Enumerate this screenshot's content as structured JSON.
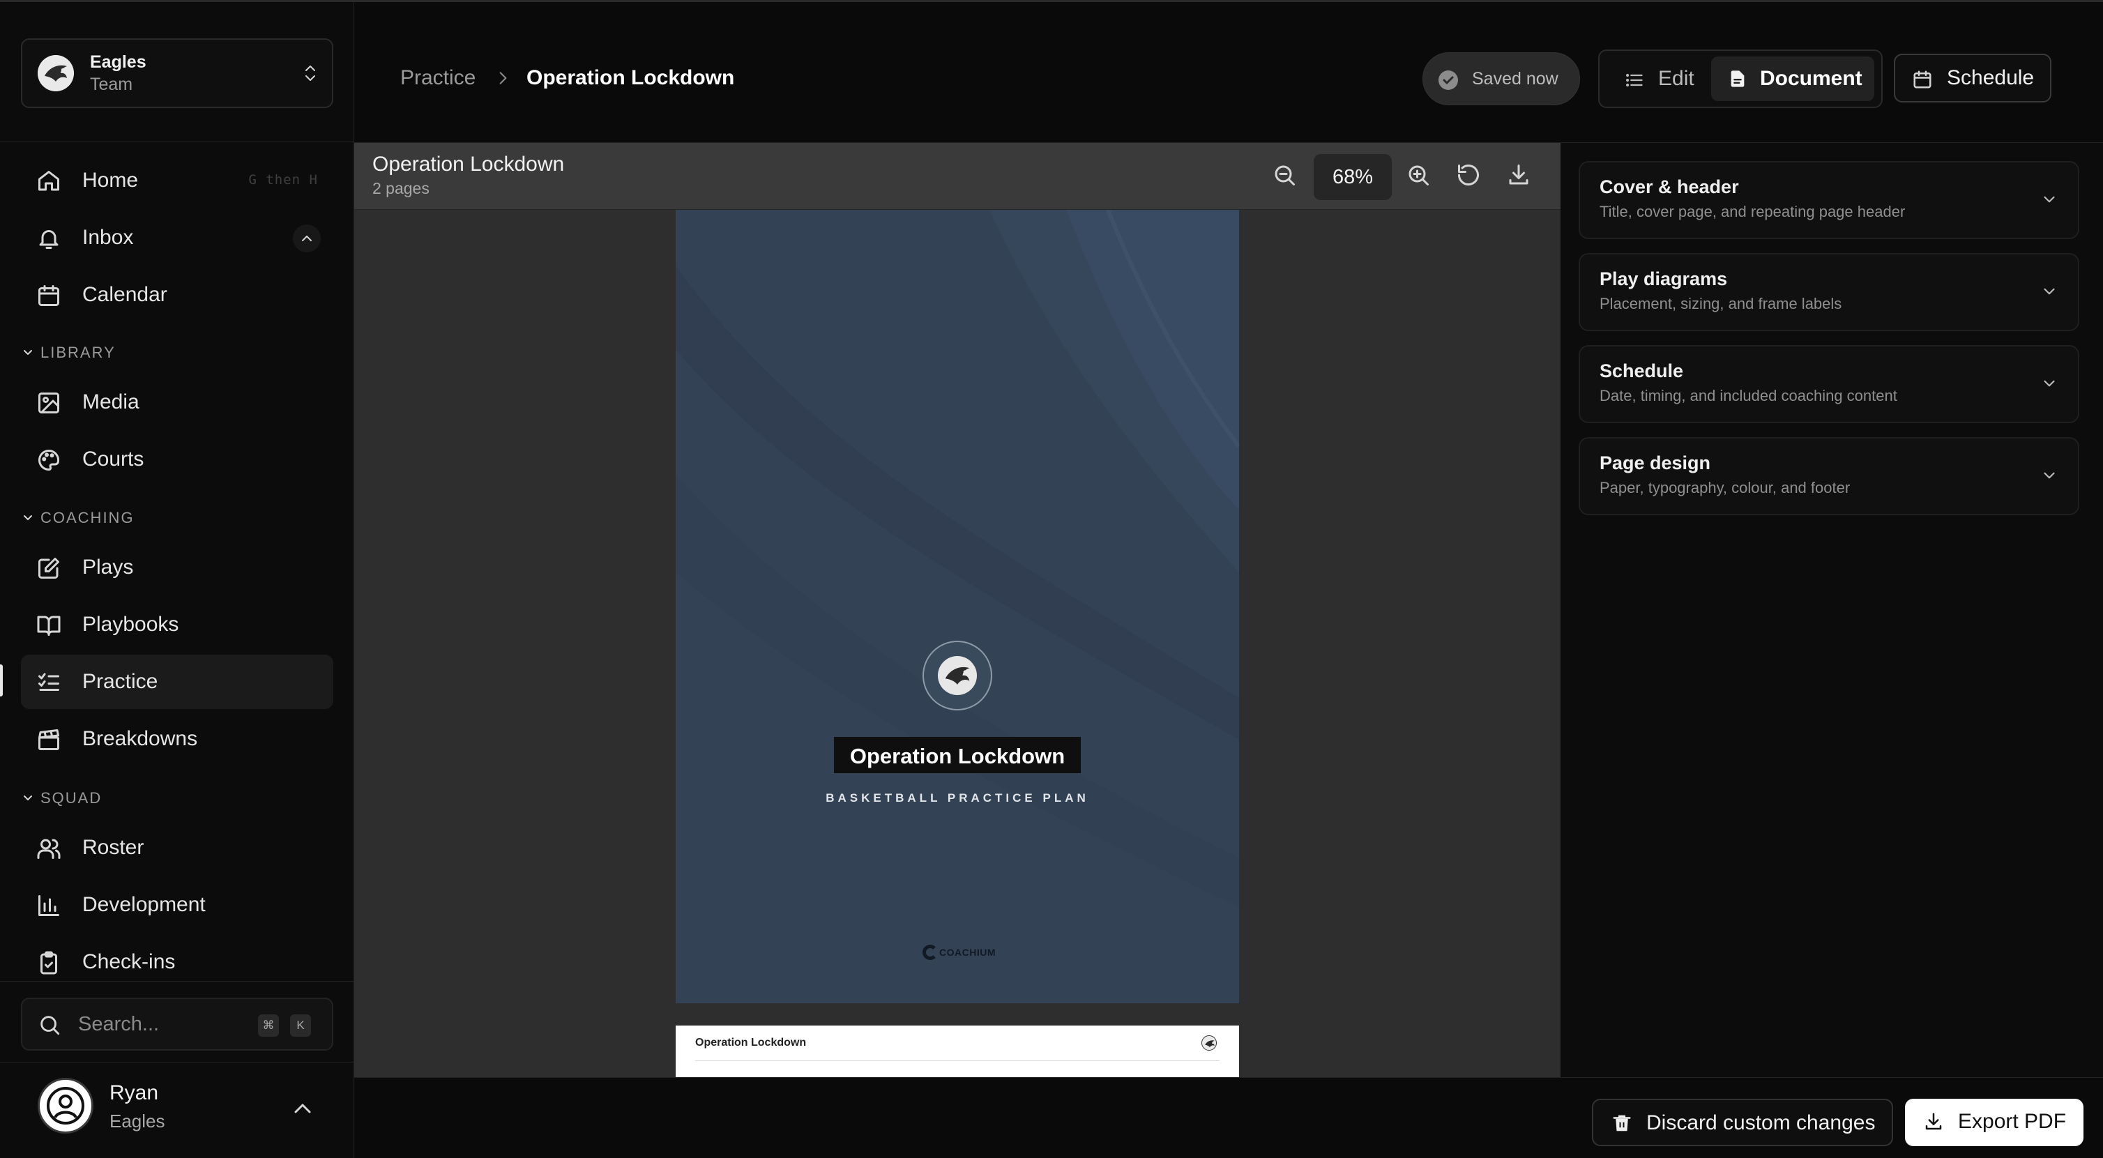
{
  "team": {
    "name": "Eagles",
    "subtitle": "Team"
  },
  "nav": {
    "home": {
      "label": "Home",
      "shortcut": "G then H"
    },
    "inbox": {
      "label": "Inbox"
    },
    "calendar": {
      "label": "Calendar"
    },
    "library_title": "LIBRARY",
    "media": {
      "label": "Media"
    },
    "courts": {
      "label": "Courts"
    },
    "coaching_title": "COACHING",
    "plays": {
      "label": "Plays"
    },
    "playbooks": {
      "label": "Playbooks"
    },
    "practice": {
      "label": "Practice"
    },
    "breakdowns": {
      "label": "Breakdowns"
    },
    "squad_title": "SQUAD",
    "roster": {
      "label": "Roster"
    },
    "development": {
      "label": "Development"
    },
    "checkins": {
      "label": "Check-ins"
    }
  },
  "search": {
    "placeholder": "Search...",
    "key1": "⌘",
    "key2": "K"
  },
  "user": {
    "name": "Ryan",
    "team": "Eagles"
  },
  "breadcrumb": {
    "parent": "Practice",
    "current": "Operation Lockdown"
  },
  "status": {
    "saved": "Saved now"
  },
  "view_toggle": {
    "edit": "Edit",
    "document": "Document",
    "active": "Document"
  },
  "schedule_button": "Schedule",
  "viewer": {
    "title": "Operation Lockdown",
    "pages": "2 pages",
    "zoom": "68%"
  },
  "cover": {
    "title": "Operation Lockdown",
    "subtitle": "BASKETBALL PRACTICE PLAN",
    "brand": "COACHIUM",
    "background_color": "#334255"
  },
  "page2": {
    "header_title": "Operation Lockdown"
  },
  "panel": {
    "sections": [
      {
        "title": "Cover & header",
        "description": "Title, cover page, and repeating page header"
      },
      {
        "title": "Play diagrams",
        "description": "Placement, sizing, and frame labels"
      },
      {
        "title": "Schedule",
        "description": "Date, timing, and included coaching content"
      },
      {
        "title": "Page design",
        "description": "Paper, typography, colour, and footer"
      }
    ]
  },
  "actions": {
    "discard": "Discard custom changes",
    "export": "Export PDF"
  }
}
